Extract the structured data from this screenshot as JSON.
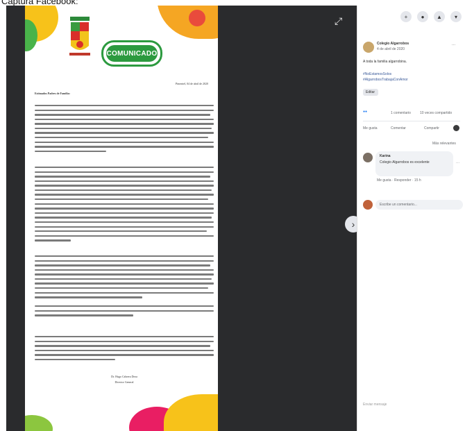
{
  "page": {
    "caption": "Captura Facebook:"
  },
  "document": {
    "banner": "COMUNICADO",
    "date": "Pimentel, 04 de abril de 2020",
    "greeting": "Estimados Padres de Familia:",
    "signature_name": "Dr. Hugo Cabrera Deza",
    "signature_title": "Director General"
  },
  "post": {
    "page_name": "Colegio Algarrobos",
    "time": "4 de abril de 2020",
    "text_1": "A toda la familia algarrobina.",
    "text_2": "#NoEstamosSolos",
    "text_3": "#AlgarrobosTrabajaConAmor",
    "translate": "Editar",
    "comments_count": "1 comentario",
    "shares_count": "10 veces compartido",
    "like_label": "Me gusta",
    "comment_label": "Comentar",
    "share_label": "Compartir",
    "more_relevant": "Más relevantes",
    "commenter": "Karina",
    "comment_text": "Colegio Algarrobos es excelente",
    "comment_actions": "Me gusta · Responder · 15 h",
    "comment_input_placeholder": "Escribe un comentario...",
    "footer": "Enviar mensaje"
  }
}
